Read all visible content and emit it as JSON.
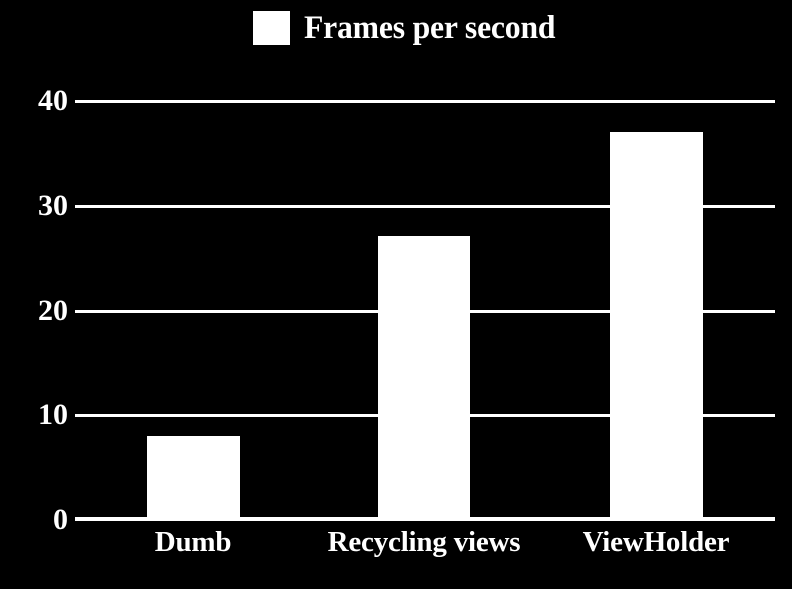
{
  "chart_data": {
    "type": "bar",
    "title": "",
    "subtitle": "",
    "categories": [
      "Dumb",
      "Recycling views",
      "ViewHolder"
    ],
    "values": [
      8,
      27,
      37
    ],
    "series": [
      {
        "name": "Frames per second",
        "values": [
          8,
          27,
          37
        ]
      }
    ],
    "xlabel": "",
    "ylabel": "",
    "ylim": [
      0,
      40
    ],
    "ytick_labels": [
      "0",
      "10",
      "20",
      "30",
      "40"
    ],
    "ytick_values": [
      0,
      10,
      20,
      30,
      40
    ],
    "grid": true,
    "grid_axis": "y",
    "legend": {
      "position": "top-center",
      "entries": [
        {
          "label": "Frames per second",
          "marker": "legend-swatch-square",
          "color": "#FFFFFF"
        }
      ]
    },
    "colors": {
      "background": "#000000",
      "bar": "#FFFFFF",
      "text": "#FFFFFF",
      "gridline": "#FFFFFF"
    }
  }
}
